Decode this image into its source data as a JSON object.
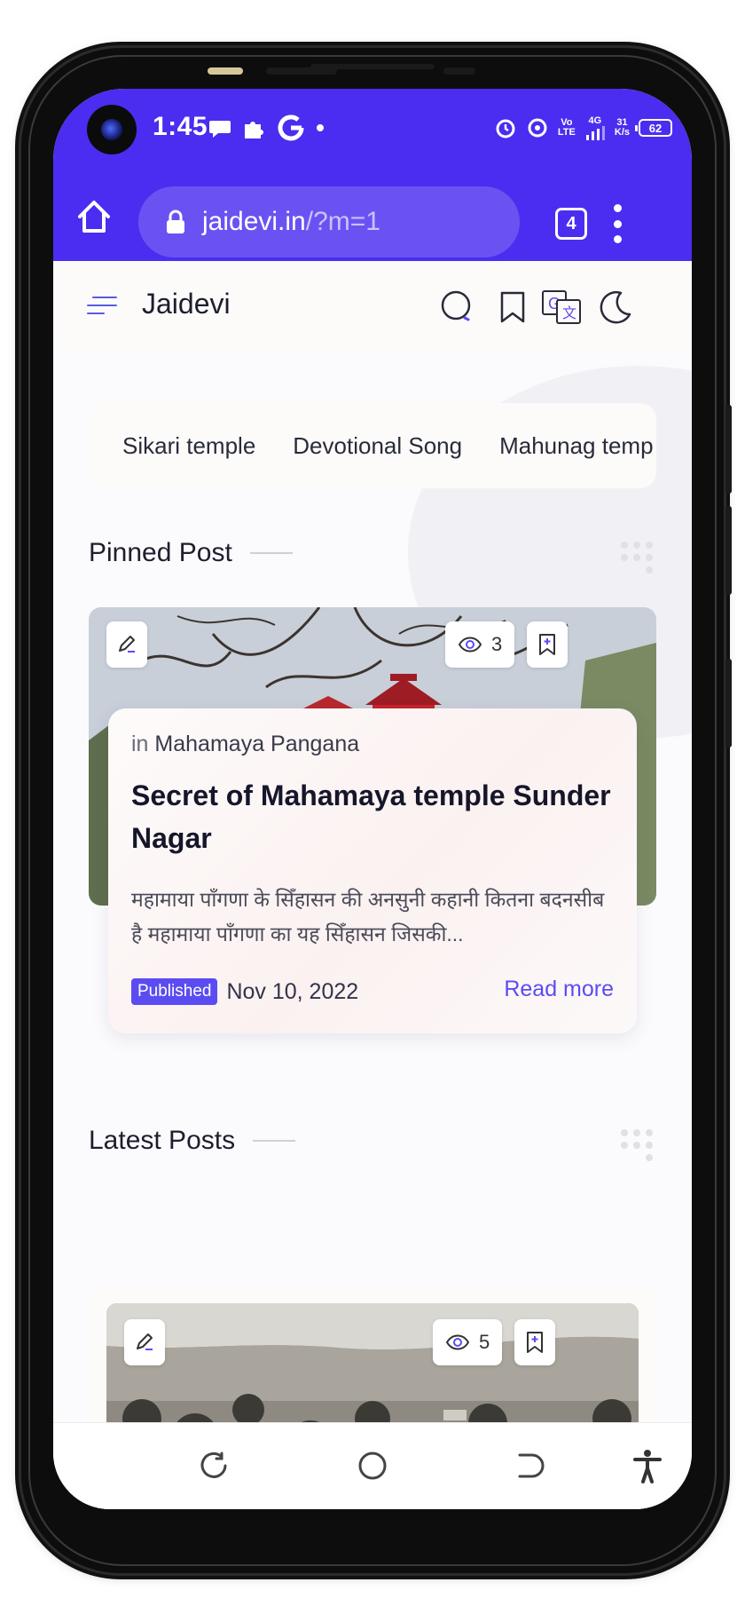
{
  "status_bar": {
    "time": "1:45",
    "network_speed_value": "31",
    "network_speed_unit": "K/s",
    "battery": "62",
    "network_type_top": "Vo",
    "network_type_bottom": "LTE",
    "signal_gen": "4G",
    "background_color": "#4a2df0"
  },
  "browser": {
    "url_host": "jaidevi.in",
    "url_path": "/?m=1",
    "tab_count": "4"
  },
  "site": {
    "title": "Jaidevi",
    "accent_color": "#5b4cf2"
  },
  "labels": [
    "Sikari temple",
    "Devotional Song",
    "Mahunag temp"
  ],
  "pinned": {
    "heading": "Pinned Post",
    "views": "3",
    "category_prefix": "in",
    "category": "Mahamaya Pangana",
    "title": "Secret of Mahamaya temple Sunder Nagar",
    "excerpt": "महामाया पाँगणा के सिँहासन की अनसुनी कहानी कितना बदनसीब है महामाया पाँगणा का यह सिँहासन जिसकी...",
    "badge": "Published",
    "date": "Nov 10, 2022",
    "read_more": "Read more"
  },
  "latest": {
    "heading": "Latest Posts",
    "first_post_views": "5"
  },
  "icons": {
    "header": [
      "menu-icon",
      "search-icon",
      "bookmark-icon",
      "translate-icon",
      "dark-mode-icon"
    ],
    "card": [
      "edit-icon",
      "eye-icon",
      "bookmark-add-icon"
    ],
    "nav": [
      "recents-icon",
      "home-icon",
      "back-icon",
      "accessibility-icon"
    ]
  }
}
